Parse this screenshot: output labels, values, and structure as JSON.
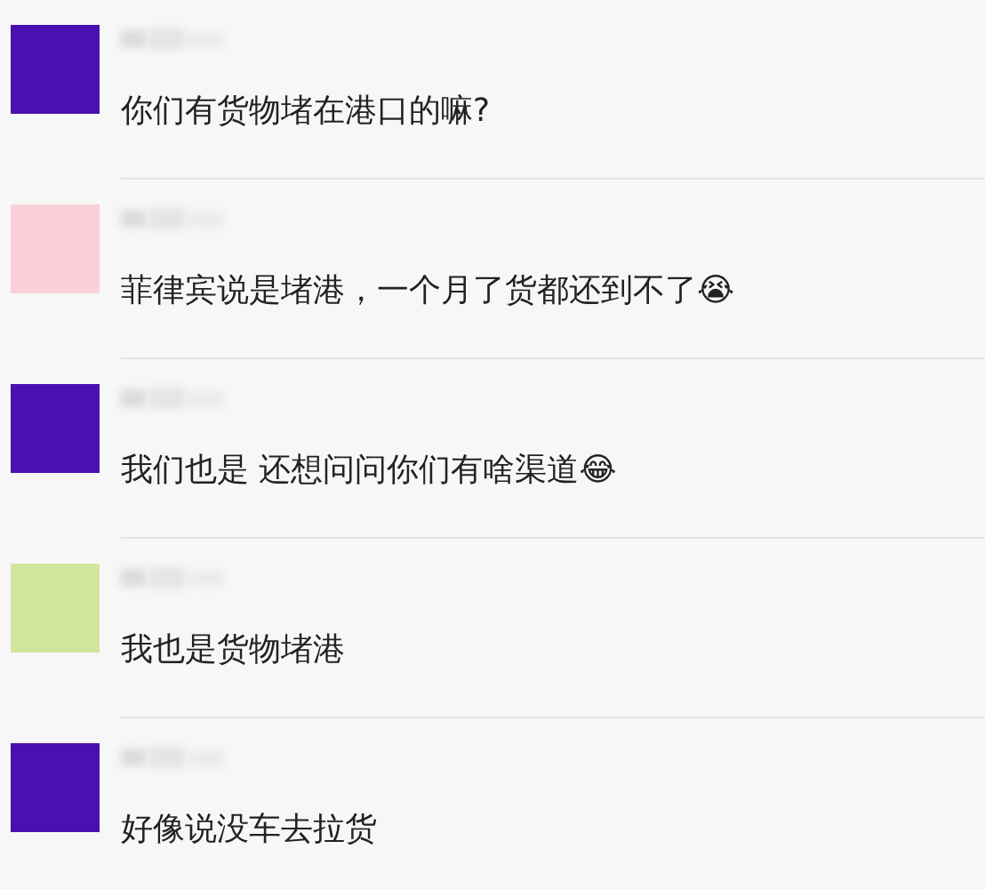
{
  "comments": [
    {
      "avatar": {
        "color": "#4a10b0"
      },
      "text": "你们有货物堵在港口的嘛?"
    },
    {
      "avatar": {
        "color": "#f9d0d8"
      },
      "text": "菲律宾说是堵港，一个月了货都还到不了😭"
    },
    {
      "avatar": {
        "color": "#4a10b0"
      },
      "text": "我们也是 还想问问你们有啥渠道😂"
    },
    {
      "avatar": {
        "color": "#d2e59c"
      },
      "text": "我也是货物堵港"
    },
    {
      "avatar": {
        "color": "#4a10b0"
      },
      "text": "好像说没车去拉货"
    }
  ]
}
